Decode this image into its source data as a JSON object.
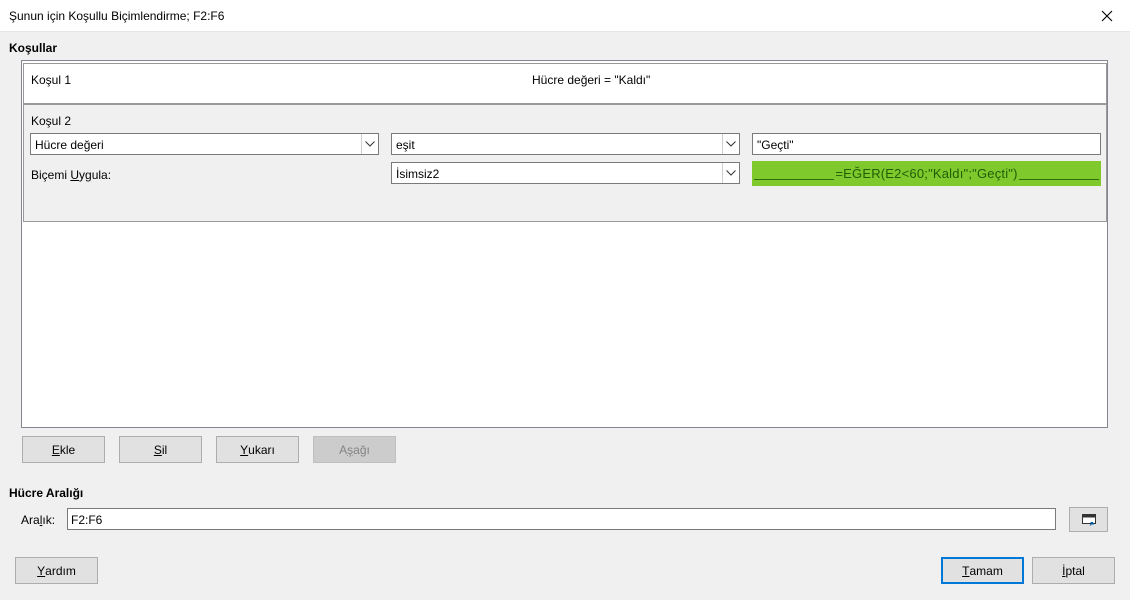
{
  "window": {
    "title": "Şunun için Koşullu Biçimlendirme; F2:F6",
    "close_icon": "close-icon"
  },
  "conditions_section": {
    "label": "Koşullar",
    "condition1": {
      "label": "Koşul 1",
      "summary": "Hücre değeri = \"Kaldı\""
    },
    "condition2": {
      "label": "Koşul 2",
      "type_value": "Hücre değeri",
      "operator_value": "eşit",
      "value_text": "\"Geçti\"",
      "apply_style_label_pre": "Biçemi ",
      "apply_style_label_key": "U",
      "apply_style_label_post": "ygula:",
      "style_value": "İsimsiz2",
      "preview_text": "=EĞER(E2<60;\"Kaldı\";\"Geçti\")",
      "preview_bg": "#7fc92c",
      "preview_fg": "#1f5f08"
    }
  },
  "buttons": {
    "add": {
      "key": "E",
      "rest": "kle"
    },
    "delete": {
      "key": "S",
      "rest": "il"
    },
    "up": {
      "key": "Y",
      "rest": "ukarı"
    },
    "down": {
      "pre": "A",
      "key": "ş",
      "rest": "ağı",
      "disabled": true
    }
  },
  "range_section": {
    "label": "Hücre Aralığı",
    "range_label_pre": "Ara",
    "range_label_key": "l",
    "range_label_post": "ık:",
    "range_value": "F2:F6",
    "shrink_icon": "shrink-range-icon"
  },
  "footer": {
    "help": {
      "key": "Y",
      "rest": "ardım"
    },
    "ok": {
      "key": "T",
      "rest": "amam"
    },
    "cancel": {
      "key": "İ",
      "rest": "ptal"
    }
  },
  "colors": {
    "accent": "#0078d7",
    "dialog_bg": "#f0f0f0"
  }
}
